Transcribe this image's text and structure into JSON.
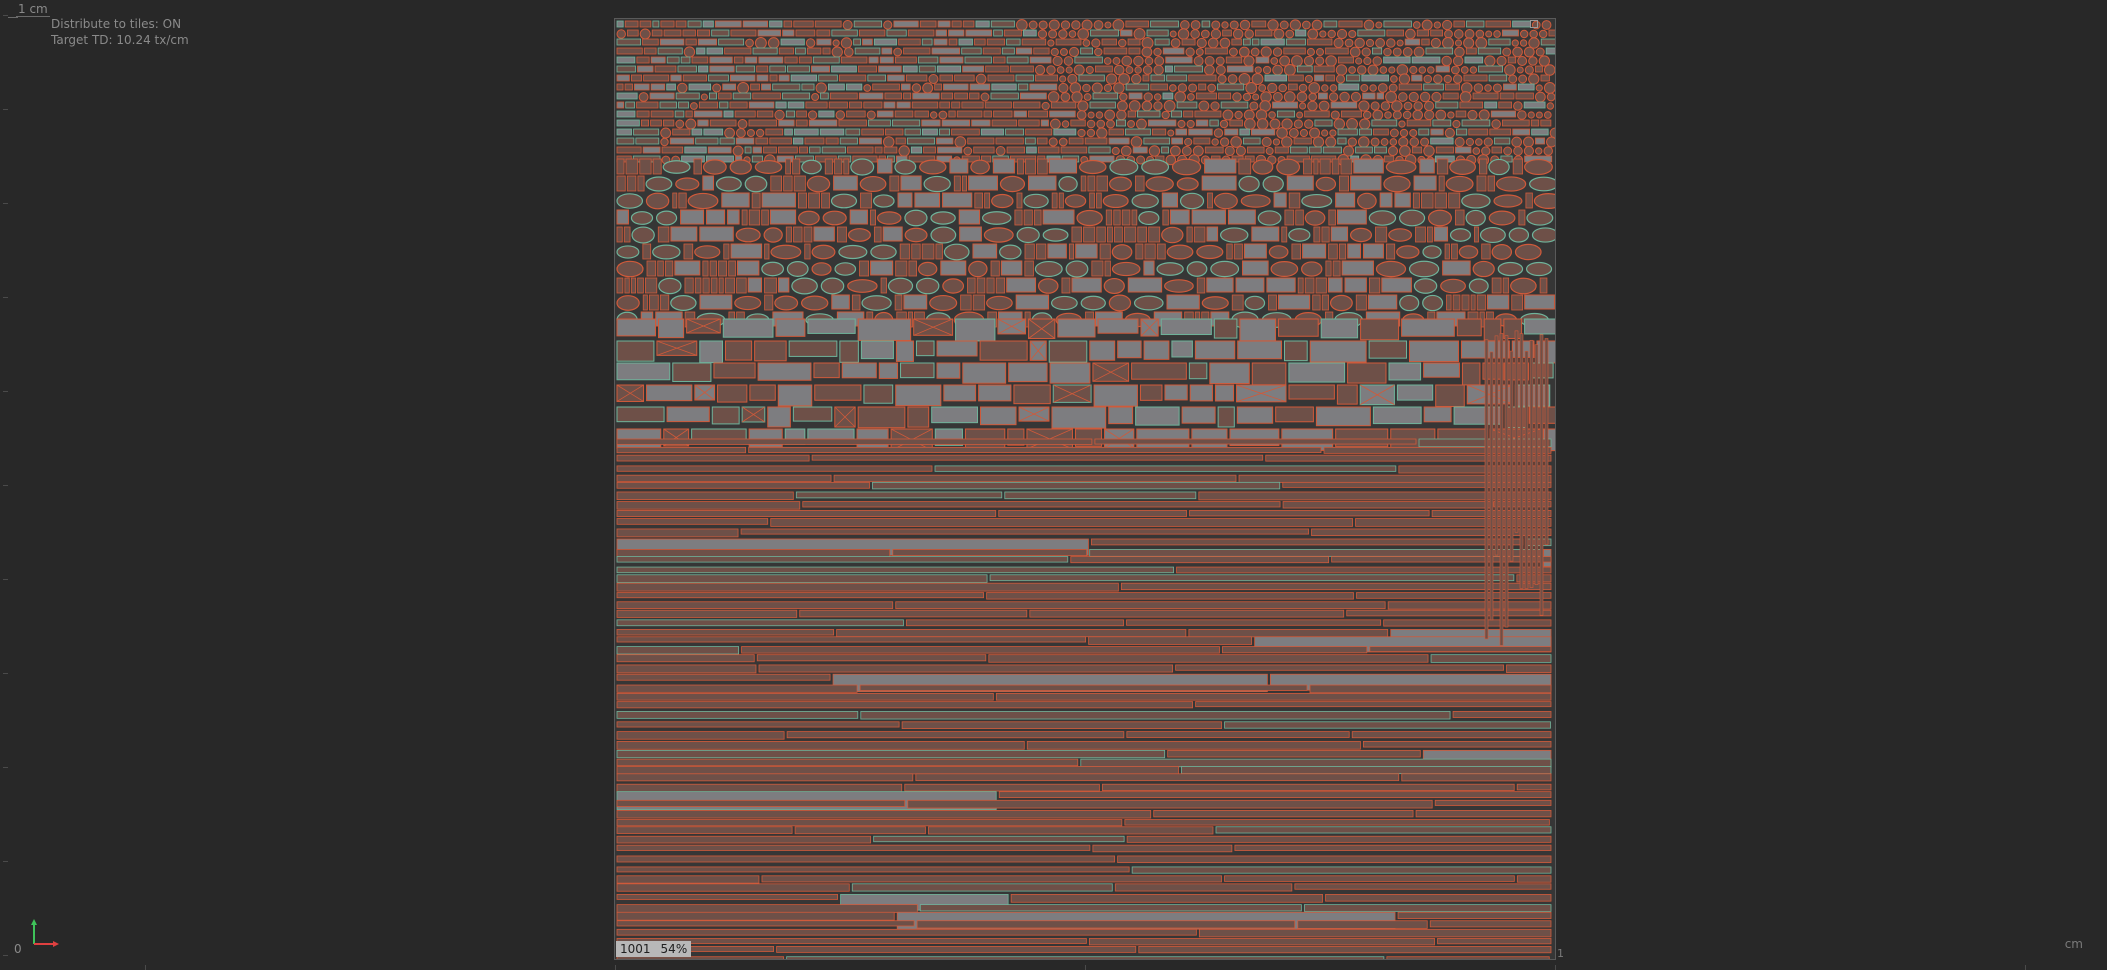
{
  "viewport": {
    "scale_label": "1 cm",
    "hud_lines": [
      "Distribute to tiles: ON",
      "Target TD: 10.24 tx/cm"
    ],
    "origin_label": "0",
    "unit_label": "cm",
    "edge_label": "1"
  },
  "tile": {
    "id": "1001",
    "zoom": "54%"
  },
  "colors": {
    "background": "#282828",
    "tile_fill": "#363636",
    "uv_edge": "#d05a3a",
    "uv_fill": "#6e5048",
    "uv_gray": "#7d7d80",
    "seam": "#6fb39a",
    "axis_y": "#3fc25a",
    "axis_x": "#e04040"
  },
  "icons": {
    "axis_gizmo": "axis-gizmo-icon"
  }
}
